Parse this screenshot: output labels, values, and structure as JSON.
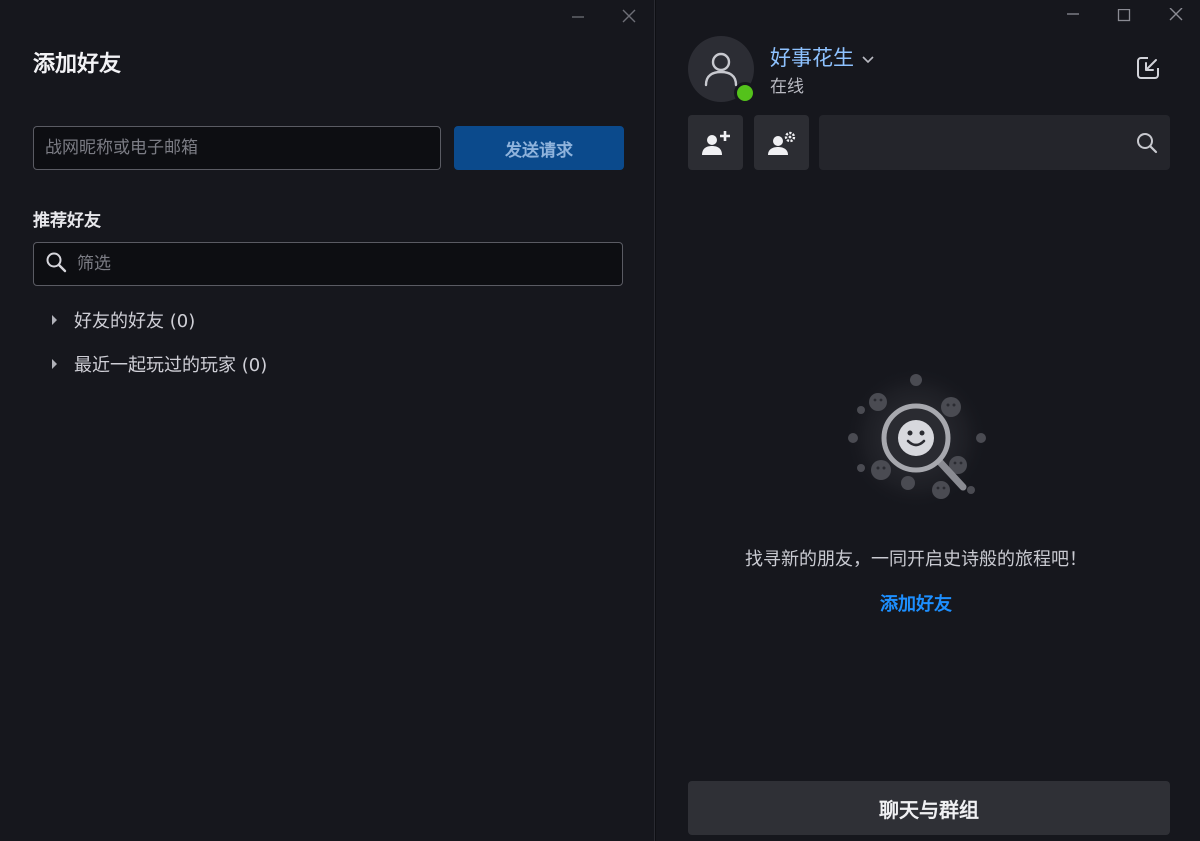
{
  "add_friend_window": {
    "title": "添加好友",
    "battletag_input": {
      "value": "",
      "placeholder": "战网昵称或电子邮箱"
    },
    "send_request_label": "发送请求",
    "recommended_heading": "推荐好友",
    "filter": {
      "value": "",
      "placeholder": "筛选"
    },
    "groups": [
      {
        "label": "好友的好友 (0)"
      },
      {
        "label": "最近一起玩过的玩家 (0)"
      }
    ]
  },
  "friends_window": {
    "user": {
      "name": "好事花生",
      "status": "在线",
      "status_color": "#54c21b"
    },
    "empty_state": {
      "message": "找寻新的朋友，一同开启史诗般的旅程吧！",
      "add_friend_link": "添加好友"
    },
    "chats_groups_label": "聊天与群组"
  },
  "colors": {
    "accent_link": "#1d8fff",
    "primary_button": "#0b4a8c",
    "username": "#8ec2ff"
  },
  "icons": [
    "minimize-icon",
    "close-icon",
    "maximize-icon",
    "search-icon",
    "avatar-placeholder-icon",
    "chevron-down-icon",
    "popout-icon",
    "add-friend-icon",
    "manage-friends-icon",
    "smiley-magnifier-illustration"
  ]
}
